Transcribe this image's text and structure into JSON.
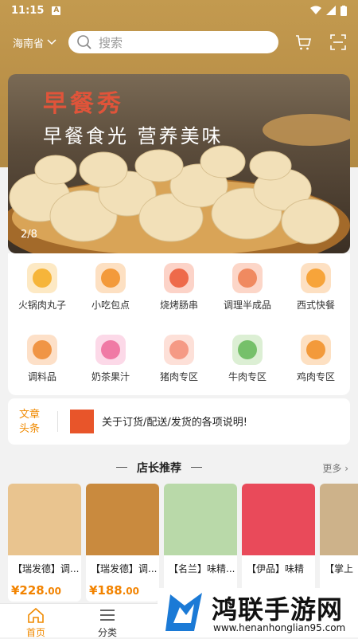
{
  "status": {
    "time": "11:15",
    "badge": "A"
  },
  "header": {
    "location": "海南省",
    "search_placeholder": "搜索"
  },
  "banner": {
    "title": "早餐秀",
    "subtitle": "早餐食光 营养美味",
    "pager": "2/8"
  },
  "categories": [
    {
      "label": "火锅肉丸子",
      "color": "#f6b53a"
    },
    {
      "label": "小吃包点",
      "color": "#f39a3b"
    },
    {
      "label": "烧烤肠串",
      "color": "#ee6a4a"
    },
    {
      "label": "调理半成品",
      "color": "#f08a60"
    },
    {
      "label": "西式快餐",
      "color": "#f7a43a"
    },
    {
      "label": "调料品",
      "color": "#f09545"
    },
    {
      "label": "奶茶果汁",
      "color": "#f07aa5"
    },
    {
      "label": "猪肉专区",
      "color": "#f59a85"
    },
    {
      "label": "牛肉专区",
      "color": "#76c06a"
    },
    {
      "label": "鸡肉专区",
      "color": "#f39a3b"
    }
  ],
  "notice": {
    "tag_line1": "文章",
    "tag_line2": "头条",
    "text": "关于订货/配送/发货的各项说明!"
  },
  "recommend": {
    "title": "店长推荐",
    "more": "更多"
  },
  "products": [
    {
      "name": "【瑞发德】调...",
      "price_int": "¥228",
      "price_dec": ".00",
      "color": "#e9c48f"
    },
    {
      "name": "【瑞发德】调...",
      "price_int": "¥188",
      "price_dec": ".00",
      "color": "#c98a3e"
    },
    {
      "name": "【名兰】味精...",
      "price_int": "",
      "price_dec": "",
      "color": "#b9d9a9"
    },
    {
      "name": "【伊品】味精",
      "price_int": "",
      "price_dec": "",
      "color": "#e94a5a"
    },
    {
      "name": "【掌上",
      "price_int": "",
      "price_dec": "",
      "color": "#cdb28a"
    }
  ],
  "tabs": [
    {
      "label": "首页",
      "active": true
    },
    {
      "label": "分类",
      "active": false
    }
  ],
  "watermark": {
    "main": "鸿联手游网",
    "url": "www.henanhonglian95.com"
  },
  "colors": {
    "brand": "#b8904a",
    "accent": "#f08a00"
  }
}
